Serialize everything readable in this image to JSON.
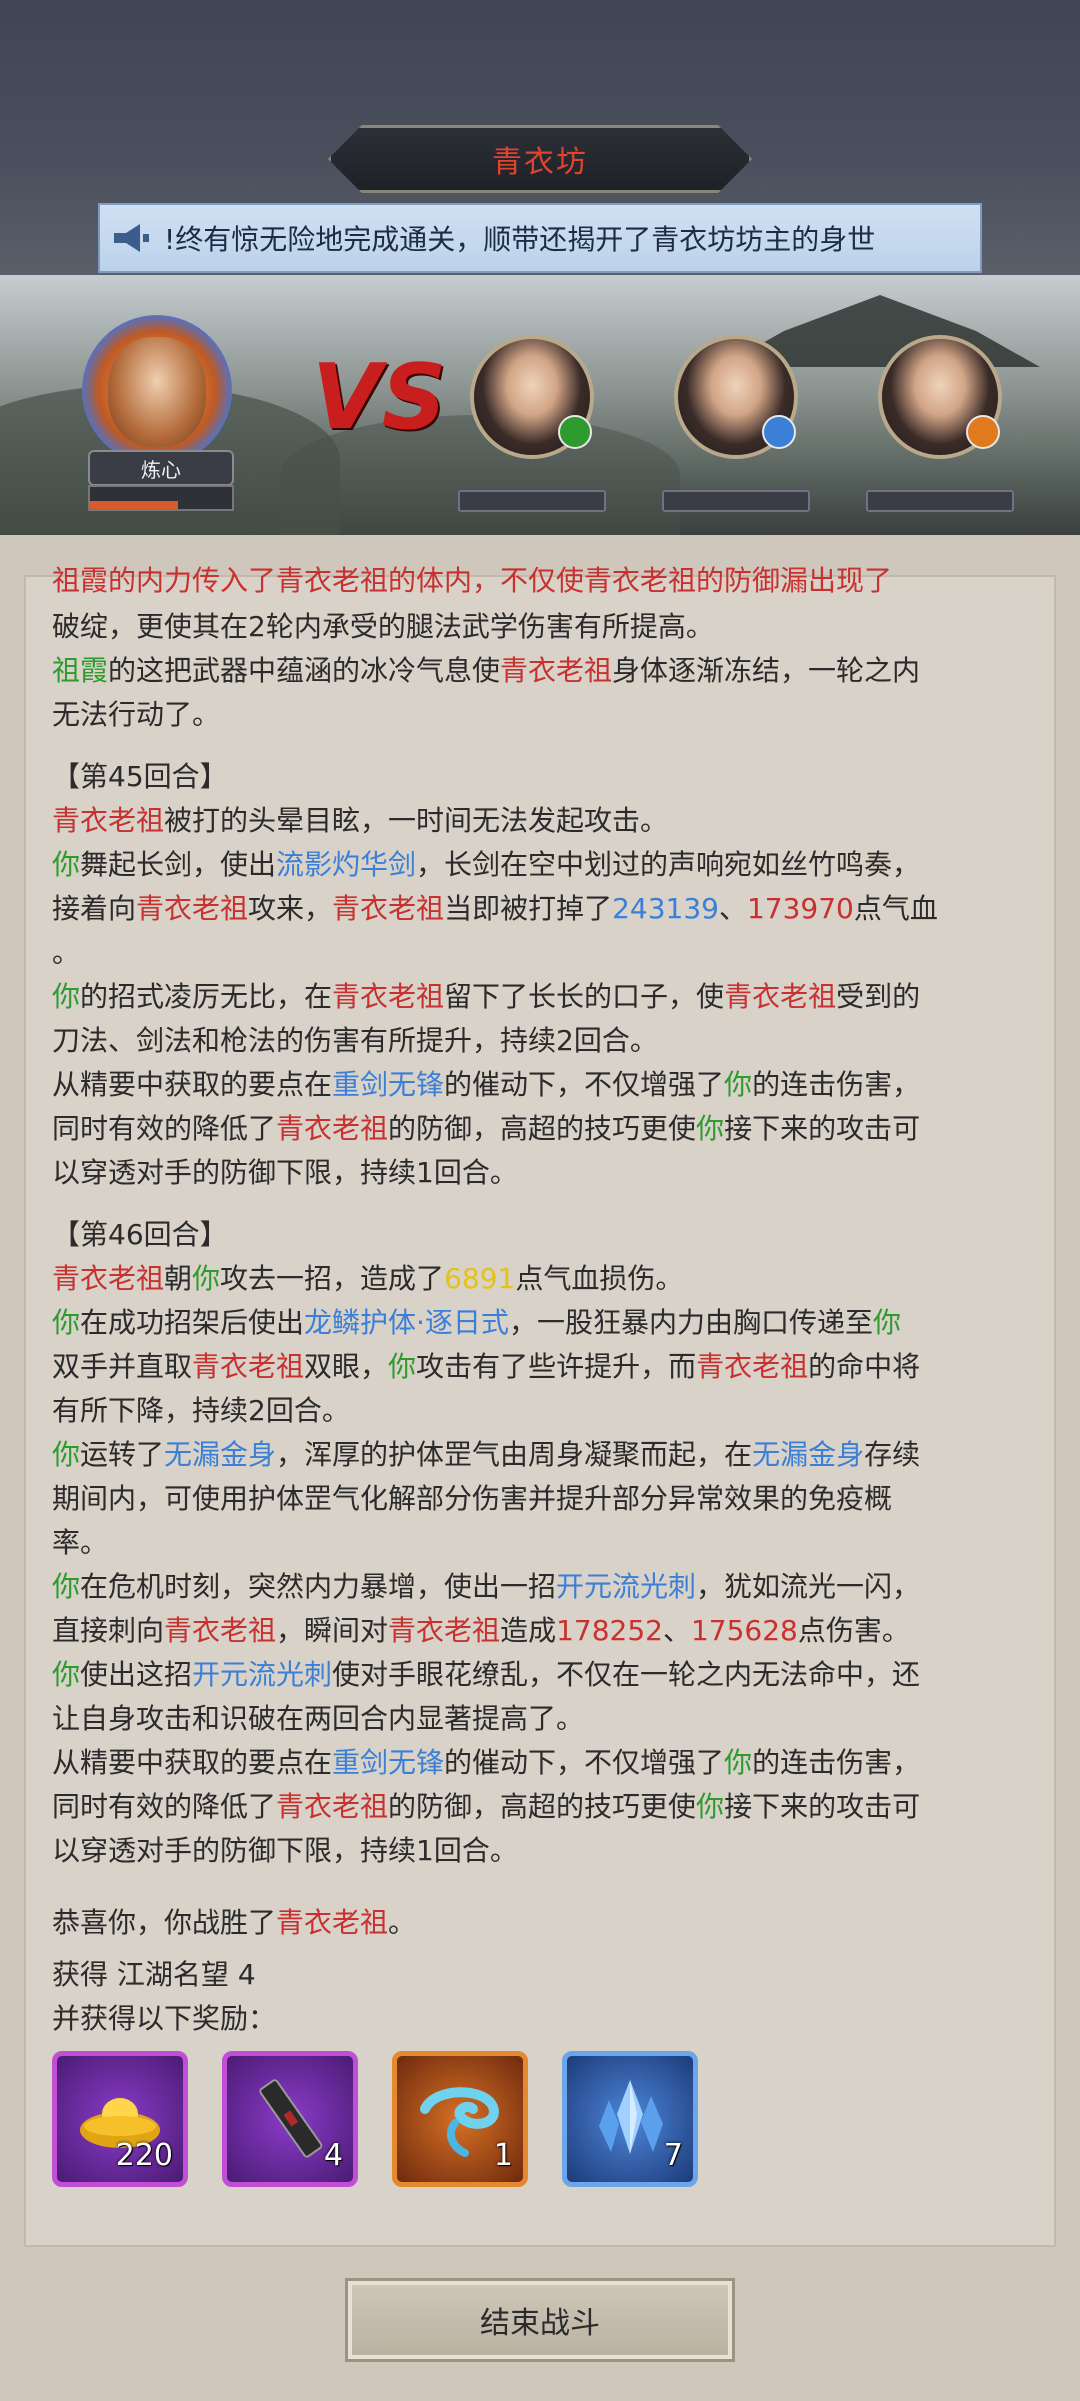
{
  "header": {
    "title": "青衣坊",
    "marquee": "!终有惊无险地完成通关，顺带还揭开了青衣坊坊主的身世"
  },
  "battle": {
    "player_name": "炼心",
    "player_hp": 0.62,
    "vs": "VS",
    "enemies": [
      {
        "badge": "green",
        "badge_color": "#2f9b2f"
      },
      {
        "badge": "blue",
        "badge_color": "#3b7fd6"
      },
      {
        "badge": "orange",
        "badge_color": "#e07a1c"
      }
    ]
  },
  "log": {
    "clipped_line": "祖霞的内力传入了青衣老祖的体内，不仅使青衣老祖的防御漏出现了",
    "l1": "破绽，更使其在2轮内承受的腿法武学伤害有所提高。",
    "l2": {
      "a": "祖霞",
      "b": "的这把武器中蕴涵的冰冷气息使",
      "c": "青衣老祖",
      "d": "身体逐渐冻结，一轮之内"
    },
    "l3": "无法行动了。",
    "round45": "【第45回合】",
    "r45a": {
      "a": "青衣老祖",
      "b": "被打的头晕目眩，一时间无法发起攻击。"
    },
    "r45b": {
      "a": "你",
      "b": "舞起长剑，使出",
      "c": "流影灼华剑",
      "d": "，长剑在空中划过的声响宛如丝竹鸣奏，"
    },
    "r45c": {
      "a": "接着向",
      "b": "青衣老祖",
      "c": "攻来，",
      "d": "青衣老祖",
      "e": "当即被打掉了",
      "f": "243139",
      "g": "、",
      "h": "173970",
      "i": "点气血"
    },
    "r45d": "。",
    "r45e": {
      "a": "你",
      "b": "的招式凌厉无比，在",
      "c": "青衣老祖",
      "d": "留下了长长的口子，使",
      "e": "青衣老祖",
      "f": "受到的"
    },
    "r45f": "刀法、剑法和枪法的伤害有所提升，持续2回合。",
    "r45g": {
      "a": "从精要中获取的要点在",
      "b": "重剑无锋",
      "c": "的催动下，不仅增强了",
      "d": "你",
      "e": "的连击伤害，"
    },
    "r45h": {
      "a": "同时有效的降低了",
      "b": "青衣老祖",
      "c": "的防御，高超的技巧更使",
      "d": "你",
      "e": "接下来的攻击可"
    },
    "r45i": "以穿透对手的防御下限，持续1回合。",
    "round46": "【第46回合】",
    "r46a": {
      "a": "青衣老祖",
      "b": "朝",
      "c": "你",
      "d": "攻去一招，造成了",
      "e": "6891",
      "f": "点气血损伤。"
    },
    "r46b": {
      "a": "你",
      "b": "在成功招架后使出",
      "c": "龙鳞护体·逐日式",
      "d": "，一股狂暴内力由胸口传递至",
      "e": "你"
    },
    "r46c": {
      "a": "双手并直取",
      "b": "青衣老祖",
      "c": "双眼，",
      "d": "你",
      "e": "攻击有了些许提升，而",
      "f": "青衣老祖",
      "g": "的命中将"
    },
    "r46d": "有所下降，持续2回合。",
    "r46e": {
      "a": "你",
      "b": "运转了",
      "c": "无漏金身",
      "d": "，浑厚的护体罡气由周身凝聚而起，在",
      "e": "无漏金身",
      "f": "存续"
    },
    "r46f": "期间内，可使用护体罡气化解部分伤害并提升部分异常效果的免疫概",
    "r46g": "率。",
    "r46h": {
      "a": "你",
      "b": "在危机时刻，突然内力暴增，使出一招",
      "c": "开元流光刺",
      "d": "，犹如流光一闪，"
    },
    "r46i": {
      "a": "直接刺向",
      "b": "青衣老祖",
      "c": "，瞬间对",
      "d": "青衣老祖",
      "e": "造成",
      "f": "178252",
      "g": "、",
      "h": "175628",
      "i": "点伤害。"
    },
    "r46j": {
      "a": "你",
      "b": "使出这招",
      "c": "开元流光刺",
      "d": "使对手眼花缭乱，不仅在一轮之内无法命中，还"
    },
    "r46k": "让自身攻击和识破在两回合内显著提高了。",
    "r46l": {
      "a": "从精要中获取的要点在",
      "b": "重剑无锋",
      "c": "的催动下，不仅增强了",
      "d": "你",
      "e": "的连击伤害，"
    },
    "r46m": {
      "a": "同时有效的降低了",
      "b": "青衣老祖",
      "c": "的防御，高超的技巧更使",
      "d": "你",
      "e": "接下来的攻击可"
    },
    "r46n": "以穿透对手的防御下限，持续1回合。",
    "victory": {
      "a": "恭喜你，你战胜了",
      "b": "青衣老祖",
      "c": "。"
    }
  },
  "rewards": {
    "gain_label": "获得",
    "gain_value": "江湖名望 4",
    "more_label": "并获得以下奖励：",
    "items": [
      {
        "icon": "gold-ingot-icon",
        "count": "220"
      },
      {
        "icon": "scroll-icon",
        "count": "4"
      },
      {
        "icon": "blue-wisp-icon",
        "count": "1"
      },
      {
        "icon": "blue-crystal-icon",
        "count": "7"
      }
    ]
  },
  "end_button": "结束战斗"
}
